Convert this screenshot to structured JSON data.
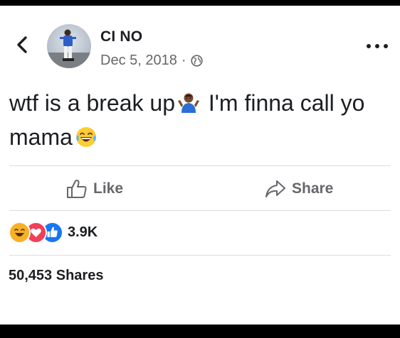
{
  "post": {
    "author": "CI NO",
    "date": "Dec 5, 2018",
    "separator": "·",
    "privacy_icon": "globe-icon",
    "text_part1": "wtf is a break up",
    "text_part2": " I'm finna call yo mama",
    "emoji1": "person-shrugging-emoji",
    "emoji2": "laughing-face-emoji"
  },
  "actions": {
    "like_label": "Like",
    "share_label": "Share"
  },
  "stats": {
    "reaction_icons": [
      "haha-reaction-icon",
      "love-reaction-icon",
      "like-reaction-icon"
    ],
    "reaction_count": "3.9K",
    "shares": "50,453 Shares"
  },
  "colors": {
    "text": "#1c1e21",
    "secondary": "#65676b",
    "like_blue": "#1877f2",
    "love_red": "#f33e58",
    "haha_yellow": "#f7b125"
  }
}
